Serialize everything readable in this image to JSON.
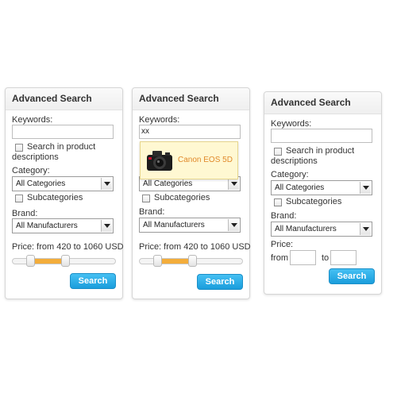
{
  "panels": [
    {
      "title": "Advanced Search",
      "keywords_label": "Keywords:",
      "keywords_value": "",
      "search_in_descriptions_label": "Search in product descriptions",
      "search_in_descriptions_line1": "Search in product",
      "search_in_descriptions_line2": "descriptions",
      "category_label": "Category:",
      "category_selected": "All Categories",
      "subcategories_label": "Subcategories",
      "brand_label": "Brand:",
      "brand_selected": "All Manufacturers",
      "price_label": "Price: from 420 to 1060 USD",
      "price_min_fraction": 0.18,
      "price_max_fraction": 0.52,
      "search_button": "Search"
    },
    {
      "title": "Advanced Search",
      "keywords_label": "Keywords:",
      "keywords_value": "xx",
      "suggestion": {
        "icon": "camera-icon",
        "text": "Canon EOS 5D"
      },
      "category_selected": "All Categories",
      "subcategories_label": "Subcategories",
      "brand_label": "Brand:",
      "brand_selected": "All Manufacturers",
      "price_label": "Price: from 420 to 1060 USD",
      "price_min_fraction": 0.18,
      "price_max_fraction": 0.52,
      "search_button": "Search"
    },
    {
      "title": "Advanced Search",
      "keywords_label": "Keywords:",
      "keywords_value": "",
      "search_in_descriptions_line1": "Search in product",
      "search_in_descriptions_line2": "descriptions",
      "category_label": "Category:",
      "category_selected": "All Categories",
      "subcategories_label": "Subcategories",
      "brand_label": "Brand:",
      "brand_selected": "All Manufacturers",
      "price_label": "Price:",
      "from_label": "from",
      "to_label": "to",
      "price_from_value": "",
      "price_to_value": "",
      "search_button": "Search"
    }
  ],
  "colors": {
    "accent_orange": "#f3ad3b",
    "button_blue": "#1a9ddc",
    "suggestion_text": "#e0892a",
    "suggestion_bg": "#fff8d2"
  }
}
